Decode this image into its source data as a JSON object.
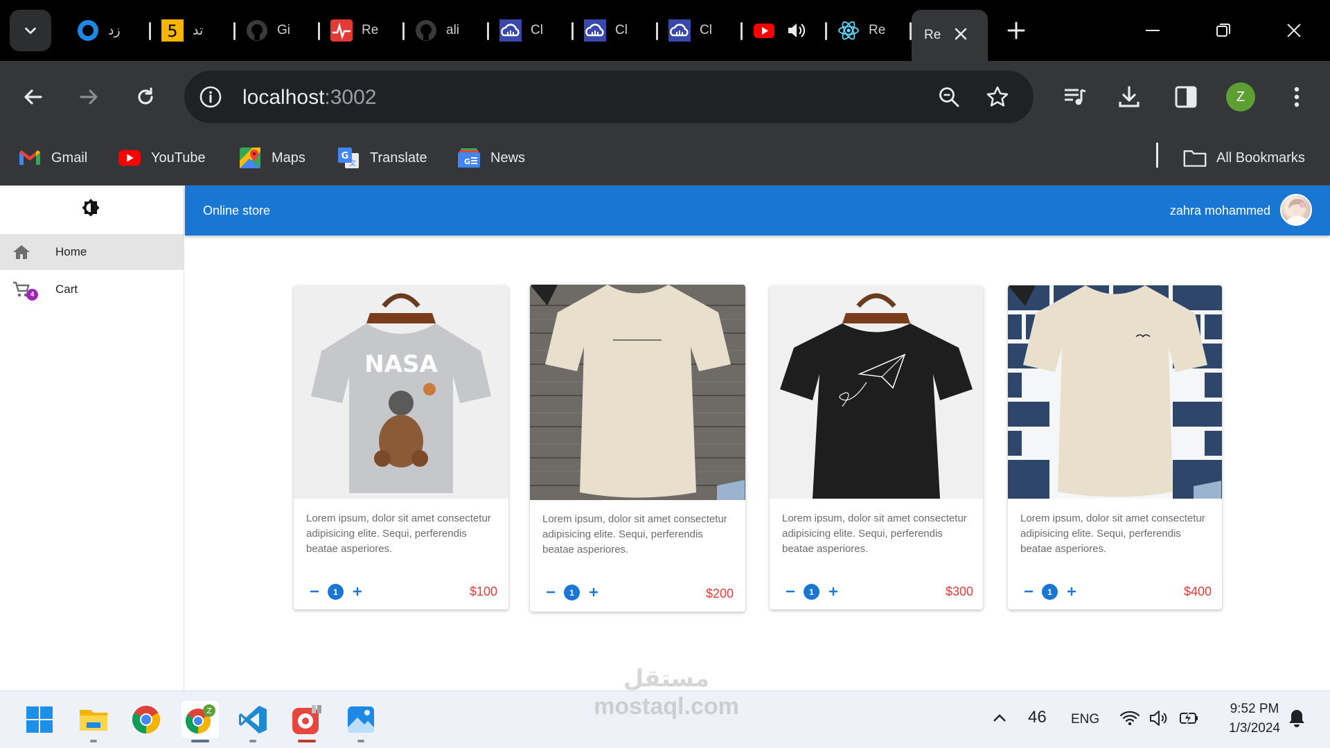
{
  "browser": {
    "tabs": [
      {
        "title": "زد",
        "icon": "circle-app-icon"
      },
      {
        "title": "تد",
        "icon": "number-five-icon"
      },
      {
        "title": "Gi",
        "icon": "github-icon"
      },
      {
        "title": "Re",
        "icon": "pulse-app-icon"
      },
      {
        "title": "ali",
        "icon": "github-icon"
      },
      {
        "title": "Cl",
        "icon": "cloud-app-icon"
      },
      {
        "title": "Cl",
        "icon": "cloud-app-icon"
      },
      {
        "title": "Cl",
        "icon": "cloud-app-icon"
      },
      {
        "title": "",
        "icon": "youtube-playing-icon"
      },
      {
        "title": "Re",
        "icon": "react-icon"
      },
      {
        "title": "Re",
        "icon": "react-icon",
        "active": true
      }
    ],
    "address": {
      "host": "localhost",
      "port": ":3002"
    },
    "profile_initial": "Z",
    "bookmarks": [
      {
        "label": "Gmail",
        "icon": "gmail-icon"
      },
      {
        "label": "YouTube",
        "icon": "youtube-icon"
      },
      {
        "label": "Maps",
        "icon": "maps-icon"
      },
      {
        "label": "Translate",
        "icon": "translate-icon"
      },
      {
        "label": "News",
        "icon": "news-icon"
      }
    ],
    "all_bookmarks": "All Bookmarks"
  },
  "app": {
    "title": "Online store",
    "user_name": "zahra mohammed",
    "nav": [
      {
        "label": "Home",
        "icon": "home-icon",
        "active": true
      },
      {
        "label": "Cart",
        "icon": "cart-icon",
        "badge": "4"
      }
    ],
    "products": [
      {
        "description": "Lorem ipsum, dolor sit amet consectetur adipisicing elite. Sequi, perferendis beatae asperiores.",
        "price": "$100",
        "quantity": "1",
        "image": "gray-nasa-tshirt"
      },
      {
        "description": "Lorem ipsum, dolor sit amet consectetur adipisicing elite. Sequi, perferendis beatae asperiores.",
        "price": "$200",
        "quantity": "1",
        "image": "beige-tshirt-wood"
      },
      {
        "description": "Lorem ipsum, dolor sit amet consectetur adipisicing elite. Sequi, perferendis beatae asperiores.",
        "price": "$300",
        "quantity": "1",
        "image": "black-paper-plane-tshirt"
      },
      {
        "description": "Lorem ipsum, dolor sit amet consectetur adipisicing elite. Sequi, perferendis beatae asperiores.",
        "price": "$400",
        "quantity": "1",
        "image": "beige-tshirt-brick"
      }
    ]
  },
  "taskbar": {
    "temperature": "46",
    "language": "ENG",
    "time": "9:52 PM",
    "date": "1/3/2024",
    "apps": [
      "windows-start-icon",
      "file-explorer-icon",
      "chrome-icon",
      "chrome-profile-icon",
      "vscode-icon",
      "app-icon",
      "photos-icon"
    ]
  },
  "watermark": {
    "line1": "مستقل",
    "line2": "mostaql.com"
  }
}
